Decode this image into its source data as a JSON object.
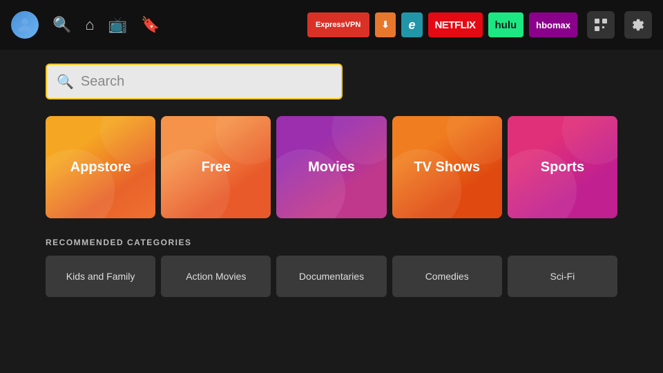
{
  "nav": {
    "apps": [
      {
        "id": "expressvpn",
        "label": "ExpressVPN",
        "class": "expressvpn"
      },
      {
        "id": "downloader",
        "label": "⬇ Downloader",
        "class": "downloader"
      },
      {
        "id": "cyber",
        "label": "ℯ",
        "class": "cyber"
      },
      {
        "id": "netflix",
        "label": "NETFLIX",
        "class": "netflix"
      },
      {
        "id": "hulu",
        "label": "hulu",
        "class": "hulu"
      },
      {
        "id": "hbomax",
        "label": "hbomax",
        "class": "hbomax"
      }
    ]
  },
  "search": {
    "placeholder": "Search"
  },
  "tiles": [
    {
      "id": "appstore",
      "label": "Appstore",
      "class": "tile-appstore"
    },
    {
      "id": "free",
      "label": "Free",
      "class": "tile-free"
    },
    {
      "id": "movies",
      "label": "Movies",
      "class": "tile-movies"
    },
    {
      "id": "tvshows",
      "label": "TV Shows",
      "class": "tile-tvshows"
    },
    {
      "id": "sports",
      "label": "Sports",
      "class": "tile-sports"
    }
  ],
  "recommended": {
    "title": "RECOMMENDED CATEGORIES",
    "items": [
      {
        "id": "kids-family",
        "label": "Kids and Family"
      },
      {
        "id": "action-movies",
        "label": "Action Movies"
      },
      {
        "id": "documentaries",
        "label": "Documentaries"
      },
      {
        "id": "comedies",
        "label": "Comedies"
      },
      {
        "id": "sci-fi",
        "label": "Sci-Fi"
      }
    ]
  }
}
